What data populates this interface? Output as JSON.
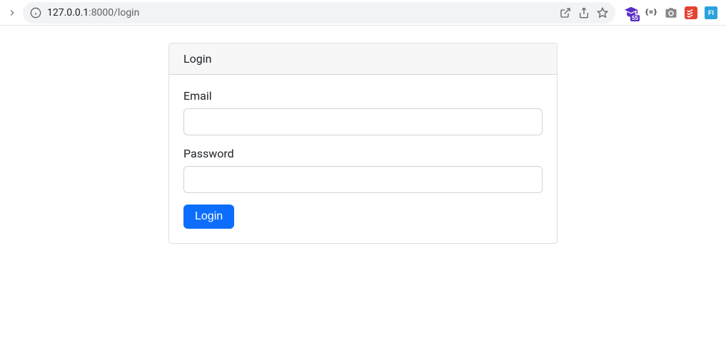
{
  "browser": {
    "url_display": "127.0.0.1:8000/login",
    "url_host": "127.0.0.1",
    "url_rest": ":8000/login"
  },
  "login": {
    "header": "Login",
    "email_label": "Email",
    "password_label": "Password",
    "submit_label": "Login"
  },
  "extensions": {
    "badge_55": "55",
    "braces": "{=}"
  }
}
